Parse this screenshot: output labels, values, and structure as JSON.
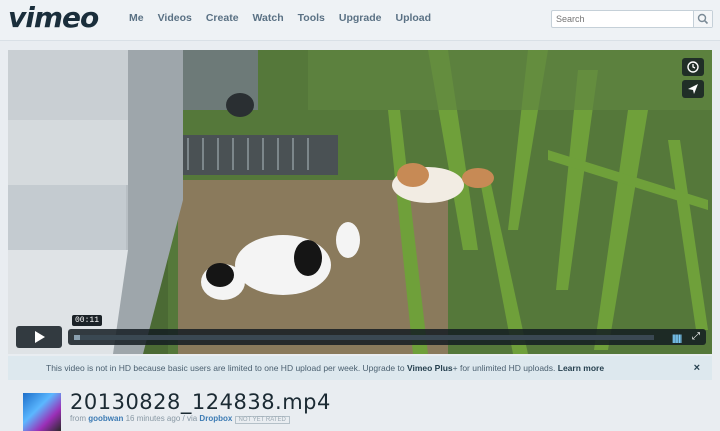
{
  "header": {
    "logo": "vimeo",
    "nav": [
      "Me",
      "Videos",
      "Create",
      "Watch",
      "Tools",
      "Upgrade",
      "Upload"
    ],
    "search_placeholder": "Search"
  },
  "player": {
    "timecode": "00:11",
    "progress": 0.01,
    "icons": [
      "clock-icon",
      "send-icon",
      "play-icon",
      "hd-icon",
      "fullscreen-icon"
    ]
  },
  "notice": {
    "text": "This video is not in HD because basic users are limited to one HD upload per week. Upgrade to ",
    "link1": "Vimeo Plus",
    "text2": "+ for unlimited HD uploads. ",
    "link2": "Learn more",
    "close": "×"
  },
  "video": {
    "title": "20130828_124838.mp4",
    "from": "from",
    "user": "goobwan",
    "ago": "16 minutes ago",
    "via": "/ via",
    "via_app": "Dropbox",
    "rating": "NOT YET RATED"
  }
}
